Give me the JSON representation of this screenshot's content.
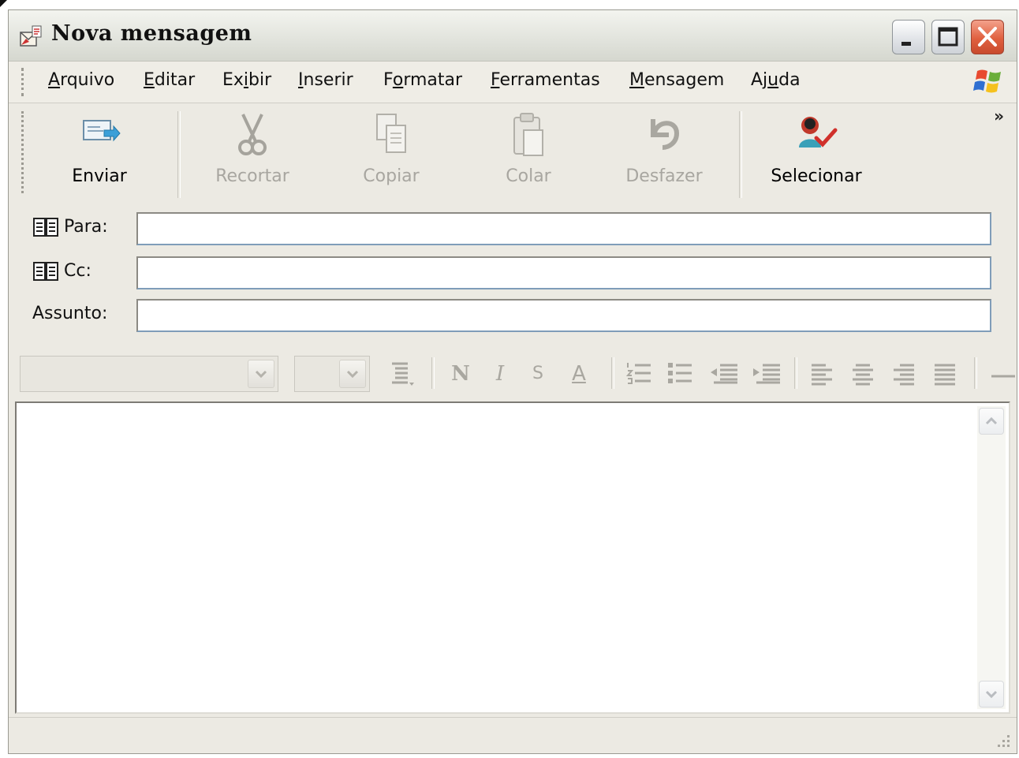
{
  "window": {
    "title": "Nova mensagem"
  },
  "menu": {
    "items": [
      {
        "pre": "",
        "u": "A",
        "post": "rquivo"
      },
      {
        "pre": "",
        "u": "E",
        "post": "ditar"
      },
      {
        "pre": "Ex",
        "u": "i",
        "post": "bir"
      },
      {
        "pre": "",
        "u": "I",
        "post": "nserir"
      },
      {
        "pre": "F",
        "u": "o",
        "post": "rmatar"
      },
      {
        "pre": "",
        "u": "F",
        "post": "erramentas"
      },
      {
        "pre": "",
        "u": "M",
        "post": "ensagem"
      },
      {
        "pre": "Aj",
        "u": "u",
        "post": "da"
      }
    ]
  },
  "toolbar": {
    "send": "Enviar",
    "cut": "Recortar",
    "copy": "Copiar",
    "paste": "Colar",
    "undo": "Desfazer",
    "select": "Selecionar",
    "more": "»"
  },
  "fields": {
    "to_label": "Para:",
    "cc_label": "Cc:",
    "subject_label": "Assunto:",
    "to_value": "",
    "cc_value": "",
    "subject_value": ""
  },
  "format": {
    "bold": "N",
    "italic": "I",
    "strike": "S",
    "font_color": "A"
  },
  "body": {
    "text": ""
  },
  "colors": {
    "close_button": "#e0603f",
    "input_border": "#7f9db9",
    "chrome": "#eceae3"
  }
}
